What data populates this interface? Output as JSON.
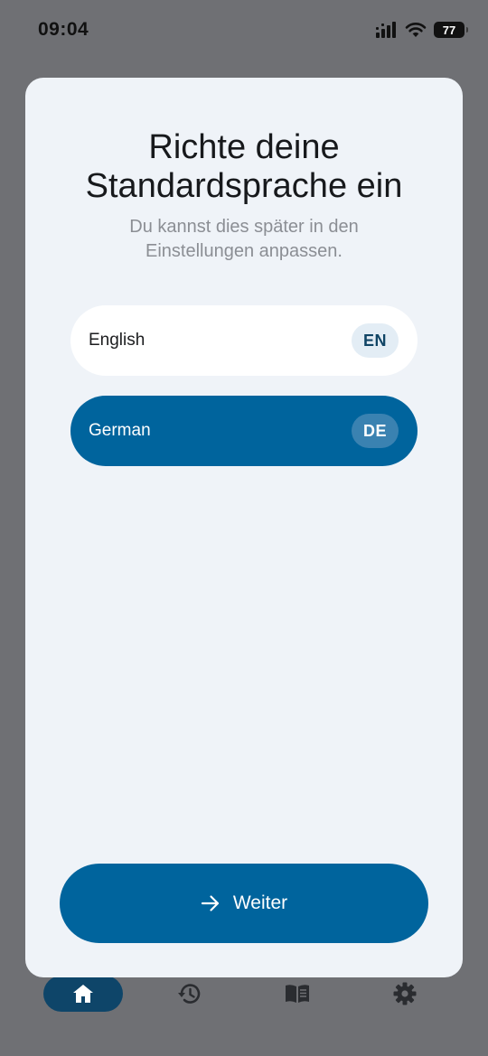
{
  "status_bar": {
    "time": "09:04",
    "battery": "77",
    "icons": [
      "signal-icon",
      "wifi-icon",
      "battery-icon"
    ]
  },
  "dialog": {
    "title_line1": "Richte deine",
    "title_line2": "Standardsprache ein",
    "subtitle_line1": "Du kannst dies später in den",
    "subtitle_line2": "Einstellungen anpassen.",
    "languages": [
      {
        "name": "English",
        "code": "EN",
        "selected": false
      },
      {
        "name": "German",
        "code": "DE",
        "selected": true
      }
    ],
    "continue_label": "Weiter",
    "continue_icon": "arrow-right-icon"
  },
  "bottom_nav": {
    "items": [
      {
        "icon": "home-icon",
        "active": true
      },
      {
        "icon": "history-icon",
        "active": false
      },
      {
        "icon": "book-icon",
        "active": false
      },
      {
        "icon": "gear-icon",
        "active": false
      }
    ]
  },
  "colors": {
    "accent": "#00649d",
    "dialog_background": "#eff3f8",
    "scrim": "#6f7074"
  }
}
